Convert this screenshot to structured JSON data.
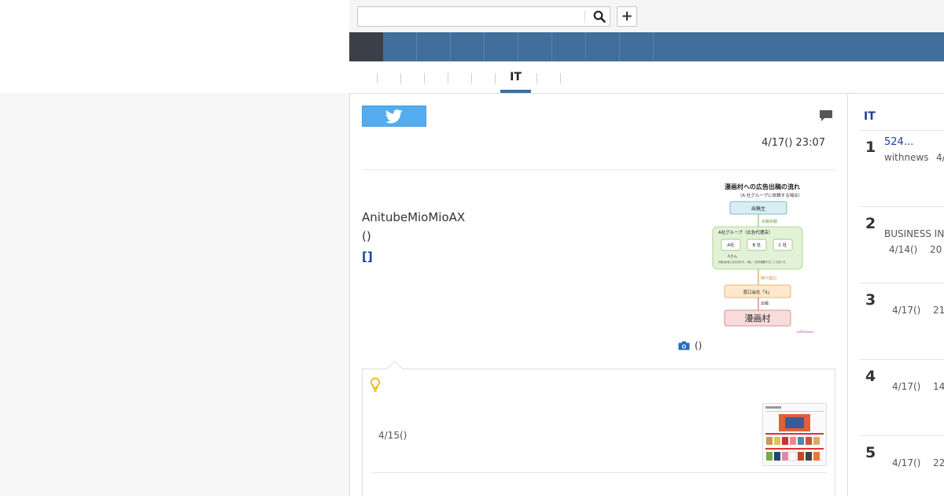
{
  "search": {
    "value": "",
    "placeholder": ""
  },
  "header": {
    "plus_label": "+"
  },
  "subtabs": {
    "active_label": "IT"
  },
  "article": {
    "datetime": "4/17() 23:07",
    "body_line1": "AnitubeMioMioAX",
    "body_line2": "()",
    "link_text": "[]",
    "photo_caption": "()",
    "figure": {
      "title": "漫画村への広告出稿の流れ",
      "subtitle": "（A 社グループに依頼する場合）",
      "box_advertiser": "出稿主",
      "arrow1": "出稿依頼",
      "group_title": "A社グループ（広告代理店）",
      "company_a": "A社",
      "company_b": "B 社",
      "company_c": "C 社",
      "person": "Aさん",
      "note": "※実はA社にある代わり、B社、C社を兼務することもあった",
      "arrow2": "仲介窓口",
      "box_window": "窓口会社「X」",
      "arrow3": "出稿",
      "box_site": "漫画村",
      "watermark": "withnews"
    }
  },
  "related": {
    "date": "4/15()"
  },
  "ranking": {
    "title": "IT",
    "items": [
      {
        "rank": "1",
        "title": "524...",
        "meta": "withnews",
        "meta2": "4/"
      },
      {
        "rank": "2",
        "title": "",
        "meta": "BUSINESS IN",
        "meta2": "4/14()",
        "meta3": "20"
      },
      {
        "rank": "3",
        "title": "",
        "meta": "4/17()",
        "meta2": "21"
      },
      {
        "rank": "4",
        "title": "",
        "meta": "4/17()",
        "meta2": "14"
      },
      {
        "rank": "5",
        "title": "",
        "meta": "4/17()",
        "meta2": "22"
      }
    ]
  },
  "colors": {
    "nav_blue": "#416e9a",
    "nav_active": "#3b3f47",
    "twitter": "#55acee",
    "link": "#1a3ea0",
    "bulb": "#e8b800"
  }
}
